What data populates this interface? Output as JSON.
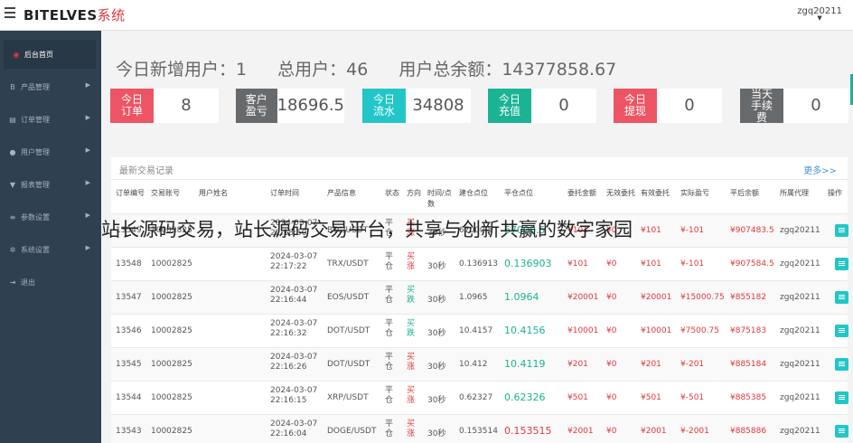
{
  "header": {
    "brand": "BITELVES",
    "brand_suffix": "系统",
    "user": "zgq20211"
  },
  "sidebar": {
    "items": [
      {
        "label": "后台首页",
        "icon": "dashboard-icon",
        "glyph": "◉",
        "active": true
      },
      {
        "label": "产品管理",
        "icon": "bitcoin-icon",
        "glyph": "B",
        "active": false
      },
      {
        "label": "订单管理",
        "icon": "order-icon",
        "glyph": "▤",
        "active": false
      },
      {
        "label": "用户管理",
        "icon": "user-icon",
        "glyph": "●",
        "active": false
      },
      {
        "label": "报表管理",
        "icon": "filter-icon",
        "glyph": "▼",
        "active": false
      },
      {
        "label": "参数设置",
        "icon": "database-icon",
        "glyph": "≡",
        "active": false
      },
      {
        "label": "系统设置",
        "icon": "cogs-icon",
        "glyph": "✲",
        "active": false
      },
      {
        "label": "退出",
        "icon": "logout-icon",
        "glyph": "⇥",
        "active": false
      }
    ]
  },
  "summary": {
    "new_users_label": "今日新增用户：",
    "new_users": "1",
    "total_users_label": "总用户：",
    "total_users": "46",
    "total_balance_label": "用户总余额：",
    "total_balance": "14377858.67"
  },
  "cards": [
    {
      "label": "今日订单",
      "value": "8",
      "color": "#ed5565"
    },
    {
      "label": "客户盈亏",
      "value": "18696.5",
      "color": "#676a6c"
    },
    {
      "label": "今日流水",
      "value": "34808",
      "color": "#23c6c8"
    },
    {
      "label": "今日充值",
      "value": "0",
      "color": "#1ab394"
    },
    {
      "label": "今日提现",
      "value": "0",
      "color": "#ed5565"
    },
    {
      "label": "当天手续费",
      "value": "0",
      "color": "#676a6c"
    }
  ],
  "panel": {
    "title": "最新交易记录",
    "more": "更多>>"
  },
  "table": {
    "headers": [
      "订单编号",
      "交易账号",
      "用户姓名",
      "订单时间",
      "产品信息",
      "状态",
      "方向",
      "时间/点数",
      "建仓点位",
      "平仓点位",
      "委托金额",
      "无效委托",
      "有效委托",
      "实际盈亏",
      "平后余额",
      "所属代理",
      "操作"
    ],
    "rows": [
      {
        "id": "13549",
        "account": "10002825",
        "name": "",
        "date": "2024-03-07",
        "time": "22:18:50",
        "product": "BTC/USDT",
        "status": "平仓",
        "dir_line1": "买",
        "dir_line2": "涨",
        "dir_color": "#e0393e",
        "duration": "30秒",
        "open": "67000.5",
        "close": "67000.5",
        "close_color": "#1ab394",
        "amount": "¥101",
        "invalid": "¥0",
        "valid": "¥101",
        "profit": "¥-101",
        "balance": "¥907483.5",
        "agent": "zgq20211"
      },
      {
        "id": "13548",
        "account": "10002825",
        "name": "",
        "date": "2024-03-07",
        "time": "22:17:22",
        "product": "TRX/USDT",
        "status": "平仓",
        "dir_line1": "买",
        "dir_line2": "涨",
        "dir_color": "#e0393e",
        "duration": "30秒",
        "open": "0.136913",
        "close": "0.136903",
        "close_color": "#1ab394",
        "amount": "¥101",
        "invalid": "¥0",
        "valid": "¥101",
        "profit": "¥-101",
        "balance": "¥907584.5",
        "agent": "zgq20211"
      },
      {
        "id": "13547",
        "account": "10002825",
        "name": "",
        "date": "2024-03-07",
        "time": "22:16:44",
        "product": "EOS/USDT",
        "status": "平仓",
        "dir_line1": "买",
        "dir_line2": "跌",
        "dir_color": "#1ab394",
        "duration": "30秒",
        "open": "1.0965",
        "close": "1.0964",
        "close_color": "#1ab394",
        "amount": "¥20001",
        "invalid": "¥0",
        "valid": "¥20001",
        "profit": "¥15000.75",
        "balance": "¥855182",
        "agent": "zgq20211"
      },
      {
        "id": "13546",
        "account": "10002825",
        "name": "",
        "date": "2024-03-07",
        "time": "22:16:32",
        "product": "DOT/USDT",
        "status": "平仓",
        "dir_line1": "买",
        "dir_line2": "跌",
        "dir_color": "#1ab394",
        "duration": "30秒",
        "open": "10.4157",
        "close": "10.4156",
        "close_color": "#1ab394",
        "amount": "¥10001",
        "invalid": "¥0",
        "valid": "¥10001",
        "profit": "¥7500.75",
        "balance": "¥875183",
        "agent": "zgq20211"
      },
      {
        "id": "13545",
        "account": "10002825",
        "name": "",
        "date": "2024-03-07",
        "time": "22:16:26",
        "product": "DOT/USDT",
        "status": "平仓",
        "dir_line1": "买",
        "dir_line2": "涨",
        "dir_color": "#e0393e",
        "duration": "30秒",
        "open": "10.412",
        "close": "10.4119",
        "close_color": "#1ab394",
        "amount": "¥201",
        "invalid": "¥0",
        "valid": "¥201",
        "profit": "¥-201",
        "balance": "¥885184",
        "agent": "zgq20211"
      },
      {
        "id": "13544",
        "account": "10002825",
        "name": "",
        "date": "2024-03-07",
        "time": "22:16:15",
        "product": "XRP/USDT",
        "status": "平仓",
        "dir_line1": "买",
        "dir_line2": "涨",
        "dir_color": "#e0393e",
        "duration": "30秒",
        "open": "0.62327",
        "close": "0.62326",
        "close_color": "#1ab394",
        "amount": "¥501",
        "invalid": "¥0",
        "valid": "¥501",
        "profit": "¥-501",
        "balance": "¥885385",
        "agent": "zgq20211"
      },
      {
        "id": "13543",
        "account": "10002825",
        "name": "",
        "date": "2024-03-07",
        "time": "22:16:04",
        "product": "DOGE/USDT",
        "status": "平仓",
        "dir_line1": "买",
        "dir_line2": "涨",
        "dir_color": "#e0393e",
        "duration": "30秒",
        "open": "0.153514",
        "close": "0.153515",
        "close_color": "#e0393e",
        "amount": "¥2001",
        "invalid": "¥0",
        "valid": "¥2001",
        "profit": "¥-2001",
        "balance": "¥885886",
        "agent": "zgq20211"
      }
    ]
  },
  "overlay_caption": "站长源码交易，站长源码交易平台，共享与创新共赢的数字家园"
}
